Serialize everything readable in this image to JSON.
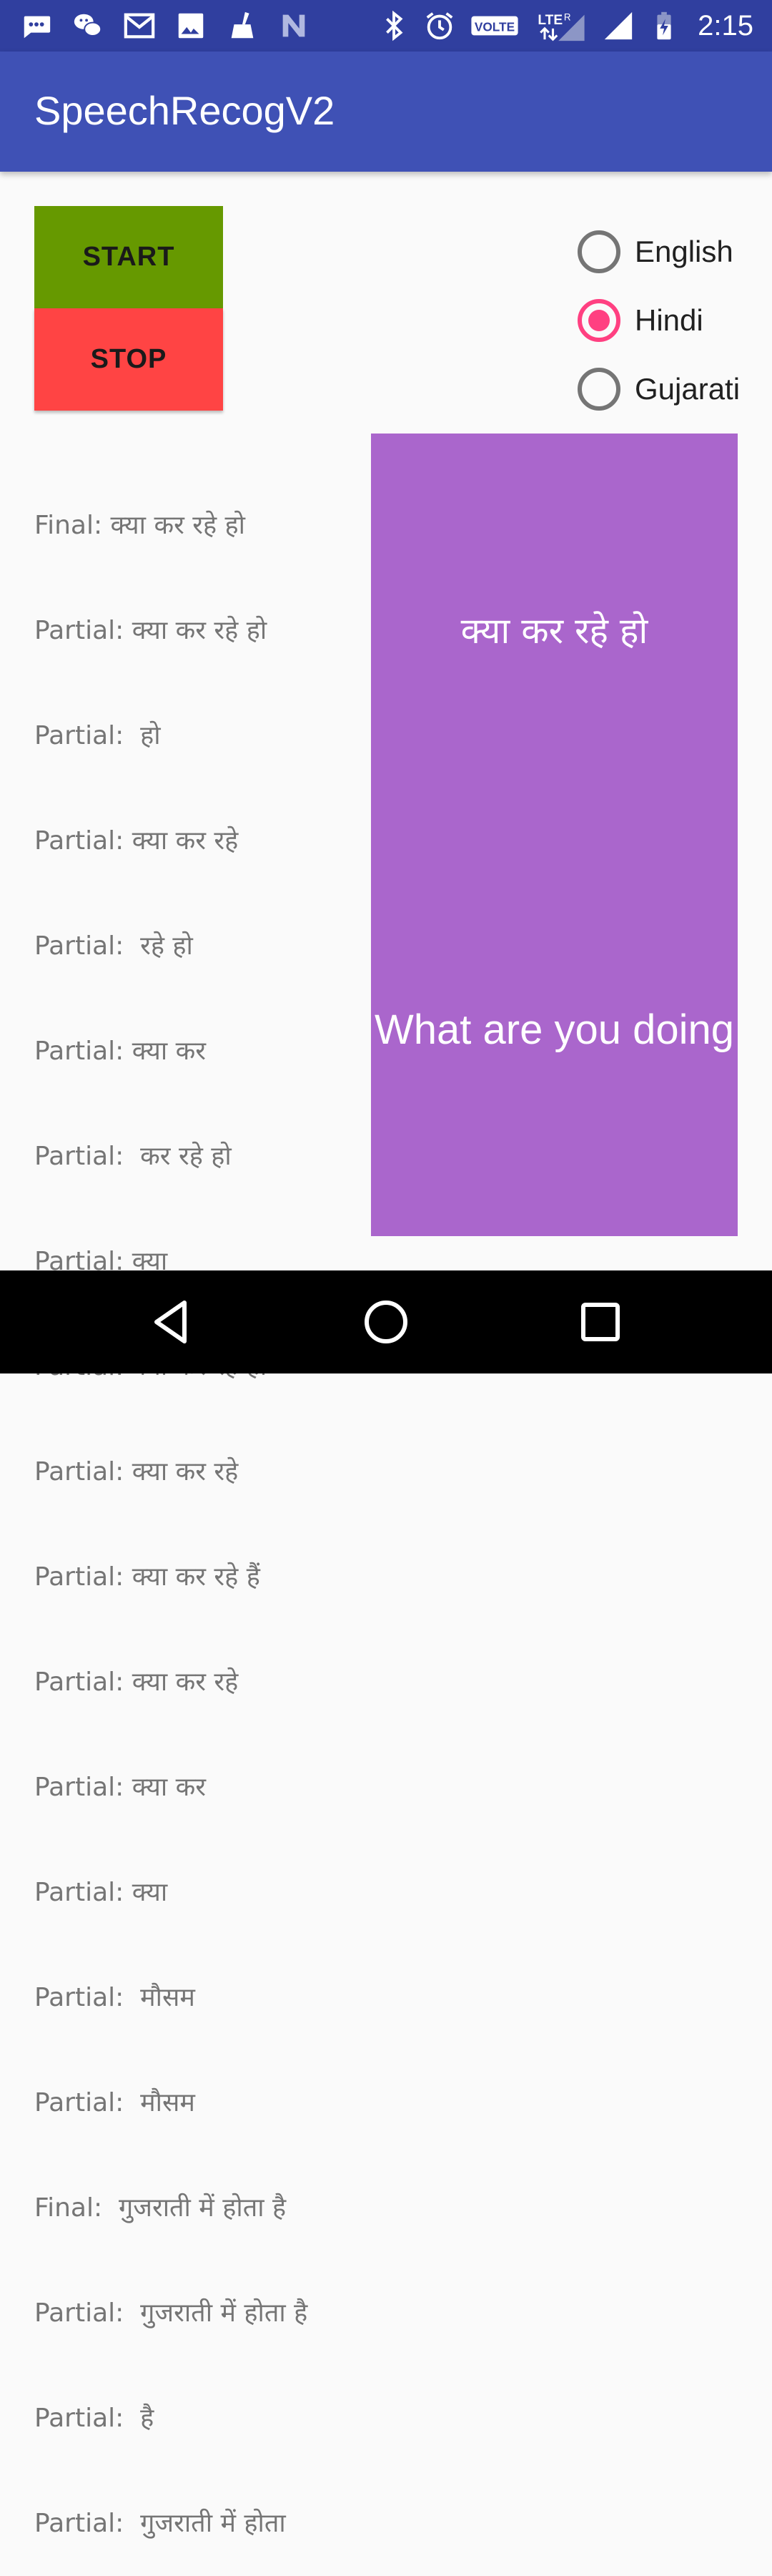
{
  "status_bar": {
    "time": "2:15",
    "left_icons": [
      "chat-bubble-icon",
      "wechat-icon",
      "gmail-icon",
      "image-icon",
      "cleaner-broom-icon",
      "n-app-icon"
    ],
    "right_icons": [
      "bluetooth-icon",
      "alarm-icon",
      "volte-icon",
      "lte-signal-icon",
      "cell-signal-icon",
      "battery-charging-icon"
    ],
    "volte_label": "VOLTE",
    "lte_label": "LTE",
    "roaming_label": "R"
  },
  "app_bar": {
    "title": "SpeechRecogV2"
  },
  "controls": {
    "start_label": "START",
    "stop_label": "STOP"
  },
  "languages": {
    "options": [
      {
        "label": "English",
        "selected": false
      },
      {
        "label": "Hindi",
        "selected": true
      },
      {
        "label": "Gujarati",
        "selected": false
      }
    ]
  },
  "log": {
    "lines": [
      "Final: क्या कर रहे हो",
      "Partial: क्या कर रहे हो",
      "Partial:  हो",
      "Partial: क्या कर रहे",
      "Partial:  रहे हो",
      "Partial: क्या कर",
      "Partial:  कर रहे हो",
      "Partial: क्या",
      "Partial: क्या कर रहे हो",
      "Partial: क्या कर रहे",
      "Partial: क्या कर रहे हैं",
      "Partial: क्या कर रहे",
      "Partial: क्या कर",
      "Partial: क्या",
      "Partial:  मौसम",
      "Partial:  मौसम",
      "Final:  गुजराती में होता है",
      "Partial:  गुजराती में होता है",
      "Partial:  है",
      "Partial:  गुजराती में होता"
    ]
  },
  "result_panel": {
    "recognized_text": "क्या कर रहे हो",
    "translated_text": "What are you doing",
    "background_color": "#aa66cc"
  },
  "colors": {
    "status_bar": "#303f9f",
    "app_bar": "#3f51b5",
    "start_button": "#669900",
    "stop_button": "#ff4444",
    "radio_accent": "#ff4081"
  },
  "nav_bar": {
    "buttons": [
      "back-icon",
      "home-icon",
      "recents-icon"
    ]
  }
}
